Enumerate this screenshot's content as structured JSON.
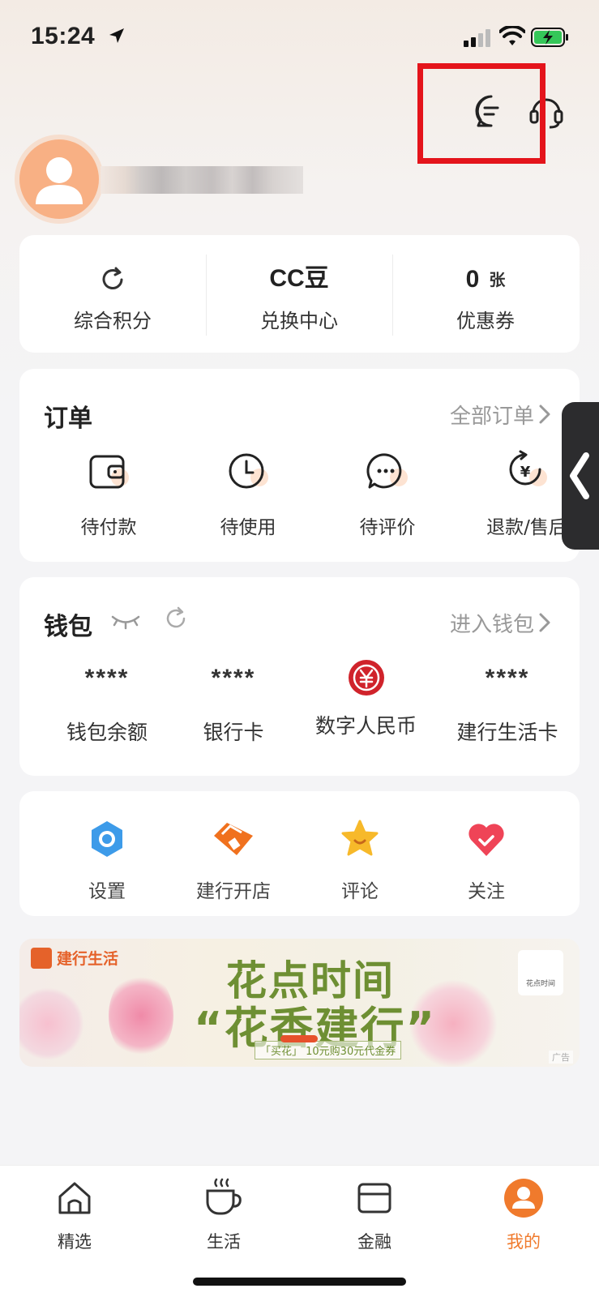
{
  "status_bar": {
    "time": "15:24"
  },
  "points": [
    {
      "value": "",
      "label": "综合积分"
    },
    {
      "value": "CC豆",
      "label": "兑换中心"
    },
    {
      "value": "0",
      "unit": "张",
      "label": "优惠券"
    }
  ],
  "orders": {
    "title": "订单",
    "link": "全部订单",
    "items": [
      {
        "label": "待付款",
        "icon": "wallet-icon"
      },
      {
        "label": "待使用",
        "icon": "clock-icon"
      },
      {
        "label": "待评价",
        "icon": "comment-icon"
      },
      {
        "label": "退款/售后",
        "icon": "refund-icon"
      }
    ]
  },
  "wallet": {
    "title": "钱包",
    "link": "进入钱包",
    "items": [
      {
        "value": "****",
        "label": "钱包余额"
      },
      {
        "value": "****",
        "label": "银行卡"
      },
      {
        "value": "",
        "label": "数字人民币"
      },
      {
        "value": "****",
        "label": "建行生活卡"
      }
    ]
  },
  "tools": [
    {
      "label": "设置",
      "icon": "settings-icon"
    },
    {
      "label": "建行开店",
      "icon": "shop-icon"
    },
    {
      "label": "评论",
      "icon": "star-icon"
    },
    {
      "label": "关注",
      "icon": "heart-icon"
    }
  ],
  "banner": {
    "brand": "建行生活",
    "title_line1": "花点时间",
    "title_line2": "“花香建行”",
    "subtitle": "「买花」 10元购30元代金券",
    "logo_text": "花点时间",
    "ad_label": "广告"
  },
  "tab_bar": {
    "items": [
      {
        "label": "精选",
        "icon": "home-icon"
      },
      {
        "label": "生活",
        "icon": "coffee-icon"
      },
      {
        "label": "金融",
        "icon": "card-icon"
      },
      {
        "label": "我的",
        "icon": "profile-icon",
        "active": true
      }
    ]
  },
  "colors": {
    "accent": "#f07a2c",
    "highlight": "#e4141b",
    "digital_rmb": "#d0232b"
  }
}
